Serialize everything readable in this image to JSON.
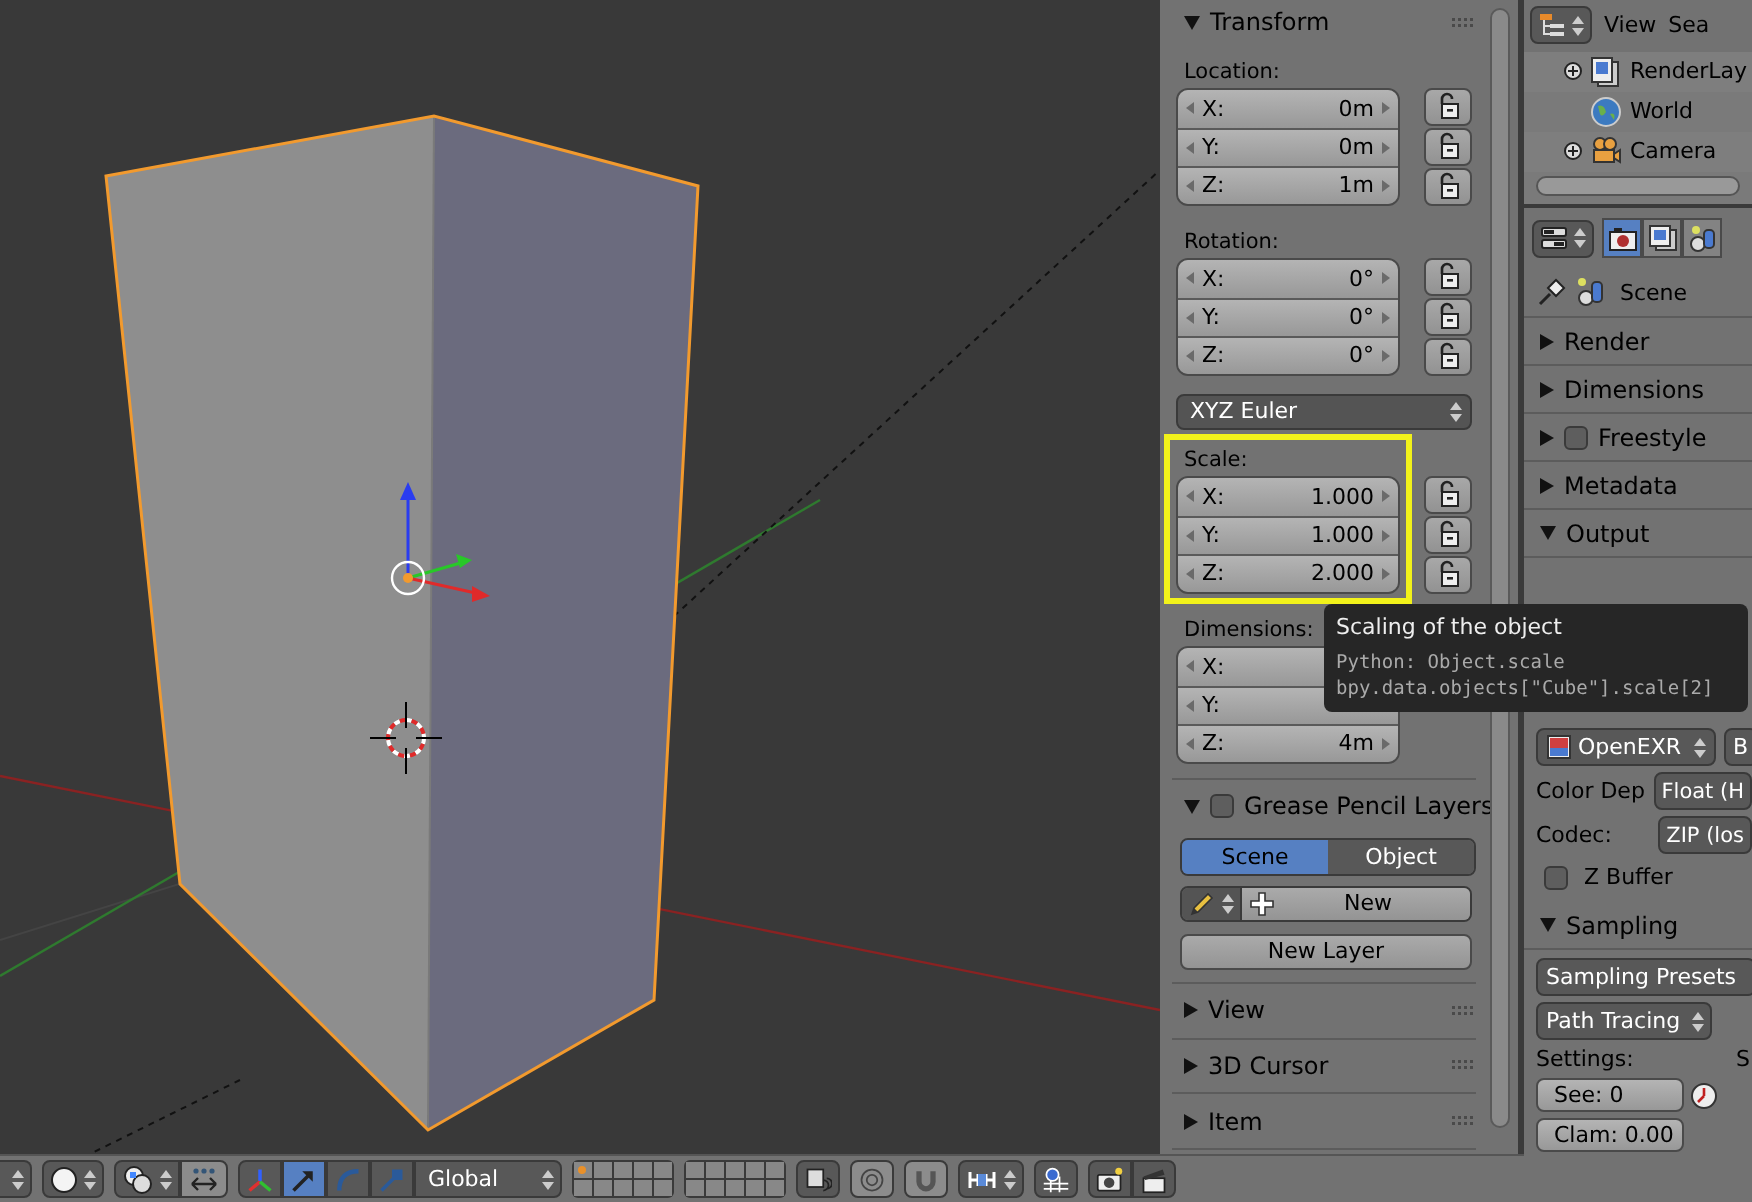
{
  "transform_panel": {
    "title": "Transform",
    "expanded": true,
    "groups": [
      {
        "kind": "vector",
        "label": "Location:",
        "highlighted": false,
        "locks": true,
        "fields": [
          {
            "axis": "X:",
            "value": "0m"
          },
          {
            "axis": "Y:",
            "value": "0m"
          },
          {
            "axis": "Z:",
            "value": "1m"
          }
        ]
      },
      {
        "kind": "vector",
        "label": "Rotation:",
        "highlighted": false,
        "locks": true,
        "fields": [
          {
            "axis": "X:",
            "value": "0°"
          },
          {
            "axis": "Y:",
            "value": "0°"
          },
          {
            "axis": "Z:",
            "value": "0°"
          }
        ]
      },
      {
        "kind": "dropdown",
        "value": "XYZ Euler"
      },
      {
        "kind": "vector",
        "label": "Scale:",
        "highlighted": true,
        "locks": true,
        "fields": [
          {
            "axis": "X:",
            "value": "1.000"
          },
          {
            "axis": "Y:",
            "value": "1.000"
          },
          {
            "axis": "Z:",
            "value": "2.000"
          }
        ]
      },
      {
        "kind": "vector",
        "label": "Dimensions:",
        "highlighted": false,
        "locks": false,
        "fields": [
          {
            "axis": "X:"
          },
          {
            "axis": "Y:"
          },
          {
            "axis": "Z:",
            "value": "4m"
          }
        ]
      }
    ]
  },
  "grease_pencil": {
    "title": "Grease Pencil Layers",
    "expanded": true,
    "enabled": false,
    "tabs": [
      {
        "label": "Scene",
        "selected": true
      },
      {
        "label": "Object",
        "selected": false
      }
    ],
    "new_button": "New",
    "new_layer_button": "New Layer"
  },
  "collapsed_panels": [
    {
      "title": "View",
      "expanded": false
    },
    {
      "title": "3D Cursor",
      "expanded": false
    },
    {
      "title": "Item",
      "expanded": false
    }
  ],
  "tooltip": {
    "title": "Scaling of the object",
    "lines": [
      "Python: Object.scale",
      "bpy.data.objects[\"Cube\"].scale[2]"
    ]
  },
  "toolbar": {
    "transform_orientation": "Global",
    "manipulators": [
      {
        "kind": "axes",
        "selected": false
      },
      {
        "kind": "translate",
        "selected": true
      },
      {
        "kind": "rotate",
        "selected": false
      },
      {
        "kind": "scale",
        "selected": false
      }
    ],
    "layers": [
      {
        "has_objects": true
      },
      {
        "has_objects": false
      },
      {
        "has_objects": false
      },
      {
        "has_objects": false
      },
      {
        "has_objects": false
      },
      {
        "has_objects": false
      },
      {
        "has_objects": false
      },
      {
        "has_objects": false
      },
      {
        "has_objects": false
      },
      {
        "has_objects": false
      },
      {
        "has_objects": false
      },
      {
        "has_objects": false
      },
      {
        "has_objects": false
      },
      {
        "has_objects": false
      },
      {
        "has_objects": false
      },
      {
        "has_objects": false
      },
      {
        "has_objects": false
      },
      {
        "has_objects": false
      },
      {
        "has_objects": false
      },
      {
        "has_objects": false
      }
    ]
  },
  "outliner": {
    "menu": [
      "View",
      "Sea"
    ],
    "items": [
      {
        "kind": "render_layers",
        "label": "RenderLay",
        "expandable": true
      },
      {
        "kind": "world",
        "label": "World",
        "expandable": false
      },
      {
        "kind": "camera",
        "label": "Camera",
        "expandable": true
      }
    ]
  },
  "properties": {
    "tabs": [
      {
        "kind": "render",
        "selected": true
      },
      {
        "kind": "render_layers",
        "selected": false
      },
      {
        "kind": "scene",
        "selected": false
      }
    ],
    "context": "Scene",
    "sections": [
      {
        "kind": "plain",
        "title": "Render",
        "expanded": false
      },
      {
        "kind": "plain",
        "title": "Dimensions",
        "expanded": false
      },
      {
        "kind": "checkbox",
        "title": "Freestyle",
        "expanded": false,
        "checked": false
      },
      {
        "kind": "plain",
        "title": "Metadata",
        "expanded": false
      },
      {
        "kind": "plain",
        "title": "Output",
        "expanded": true
      }
    ],
    "output": {
      "format": "OpenEXR",
      "format_extra": "B",
      "color_depth": {
        "label": "Color Dep",
        "value": "Float (H"
      },
      "codec": {
        "label": "Codec:",
        "value": "ZIP (los"
      },
      "z_buffer": {
        "label": "Z Buffer",
        "checked": false
      }
    },
    "sampling": {
      "title": "Sampling",
      "expanded": true,
      "presets": "Sampling Presets",
      "integrator": "Path Tracing",
      "settings_label": "Settings:",
      "column_2_label": "S",
      "seed": {
        "label": "See:",
        "value": "0"
      },
      "clamp": {
        "label": "Clam:",
        "value": "0.00"
      }
    }
  }
}
